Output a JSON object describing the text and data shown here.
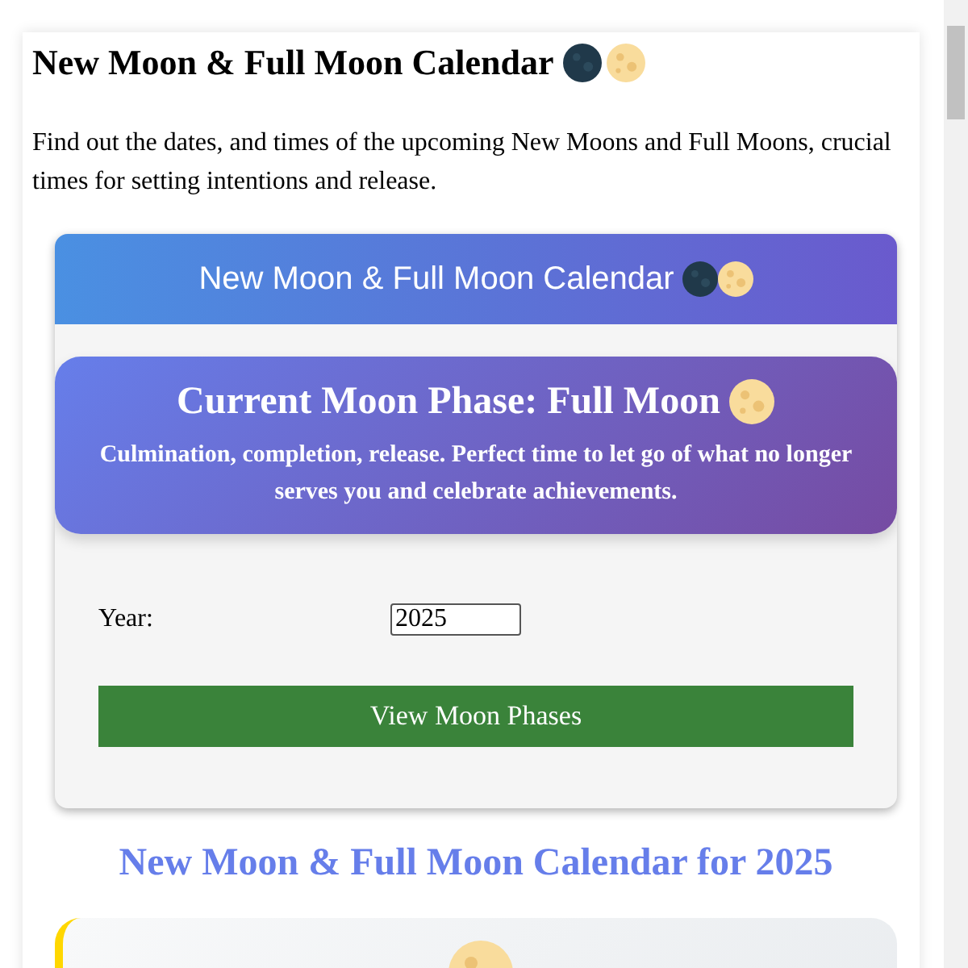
{
  "page": {
    "title": "New Moon & Full Moon Calendar",
    "intro": "Find out the dates, and times of the upcoming New Moons and Full Moons, crucial times for setting intentions and release."
  },
  "widget": {
    "header": "New Moon & Full Moon Calendar",
    "current_phase": {
      "title": "Current Moon Phase: Full Moon",
      "description": "Culmination, completion, release. Perfect time to let go of what no longer serves you and celebrate achievements."
    },
    "year_field": {
      "label": "Year:",
      "value": "2025"
    },
    "button": "View Moon Phases"
  },
  "calendar_heading": "New Moon & Full Moon Calendar for 2025"
}
